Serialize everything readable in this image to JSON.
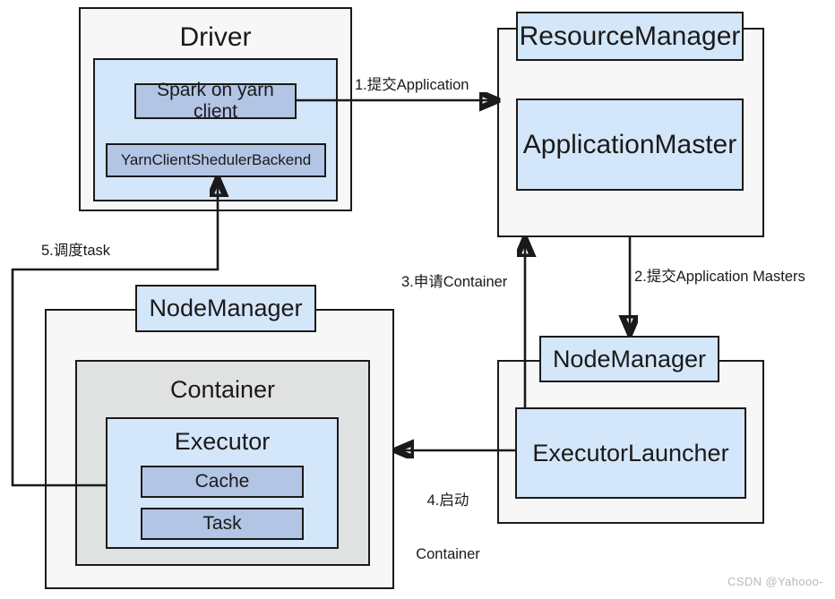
{
  "diagram": {
    "title": "Spark on YARN client mode architecture",
    "watermark": "CSDN @Yahooo-",
    "colors": {
      "outer_container_fill": "#f7f7f7",
      "container_grey_fill": "#e0e2e2",
      "blue_light": "#d4e6f9",
      "blue_mid": "#b2c5e4",
      "stroke": "#1a1a1a",
      "watermark_text": "#b9b9b9"
    }
  },
  "nodes": {
    "driver": {
      "label": "Driver",
      "inner_panel_label": "",
      "spark_client": "Spark on yarn client",
      "scheduler_backend": "YarnClientShedulerBackend"
    },
    "resource_manager": {
      "label": "ResourceManager",
      "application_master": "ApplicationMaster"
    },
    "node_manager_right": {
      "label": "NodeManager",
      "executor_launcher": "ExecutorLauncher"
    },
    "node_manager_left": {
      "label": "NodeManager",
      "container": "Container",
      "executor": "Executor",
      "cache": "Cache",
      "task": "Task"
    }
  },
  "edges": [
    {
      "id": "e1",
      "label": "1.提交Application",
      "from": "spark-on-yarn-client",
      "to": "resource-manager"
    },
    {
      "id": "e2",
      "label": "2.提交Application Masters",
      "from": "resource-manager",
      "to": "node-manager-right"
    },
    {
      "id": "e3",
      "label": "3.申请Container",
      "from": "executor-launcher",
      "to": "resource-manager"
    },
    {
      "id": "e4",
      "label_line1": "4.启动",
      "label_line2": "Container",
      "from": "executor-launcher",
      "to": "node-manager-left"
    },
    {
      "id": "e5",
      "label": "5.调度task",
      "from": "executor",
      "to": "yarn-client-sheduler-backend"
    }
  ]
}
